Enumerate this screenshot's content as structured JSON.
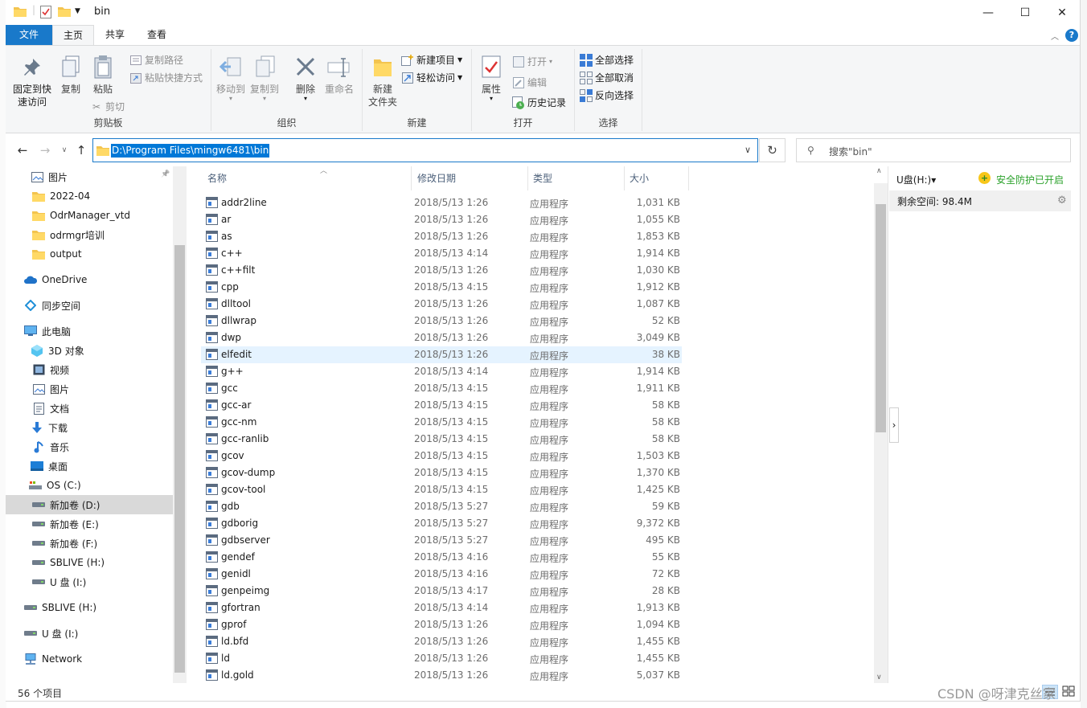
{
  "window": {
    "title": "bin",
    "controls": {
      "minimize": "—",
      "maximize": "☐",
      "close": "✕"
    }
  },
  "ribbon_tabs": [
    {
      "label": "文件"
    },
    {
      "label": "主页"
    },
    {
      "label": "共享"
    },
    {
      "label": "查看"
    }
  ],
  "ribbon": {
    "clipboard": {
      "pin_label_1": "固定到快",
      "pin_label_2": "速访问",
      "copy": "复制",
      "paste": "粘贴",
      "copy_path": "复制路径",
      "paste_shortcut": "粘贴快捷方式",
      "cut": "剪切",
      "group": "剪贴板"
    },
    "organize": {
      "move_to": "移动到",
      "copy_to": "复制到",
      "delete": "删除",
      "rename": "重命名",
      "group": "组织"
    },
    "new": {
      "new_folder_1": "新建",
      "new_folder_2": "文件夹",
      "new_item": "新建项目",
      "easy_access": "轻松访问",
      "group": "新建"
    },
    "open": {
      "properties": "属性",
      "open": "打开",
      "edit": "编辑",
      "history": "历史记录",
      "group": "打开"
    },
    "select": {
      "select_all": "全部选择",
      "select_none": "全部取消",
      "invert": "反向选择",
      "group": "选择"
    }
  },
  "address": {
    "path": "D:\\Program Files\\mingw6481\\bin"
  },
  "search": {
    "placeholder": "搜索\"bin\""
  },
  "nav": [
    {
      "label": "图片",
      "icon": "pictures-icon"
    },
    {
      "label": "2022-04",
      "icon": "folder-icon"
    },
    {
      "label": "OdrManager_vtd",
      "icon": "folder-icon"
    },
    {
      "label": "odrmgr培训",
      "icon": "folder-icon"
    },
    {
      "label": "output",
      "icon": "folder-icon"
    },
    {
      "label": "OneDrive",
      "icon": "onedrive-icon"
    },
    {
      "label": "同步空间",
      "icon": "sync-icon"
    },
    {
      "label": "此电脑",
      "icon": "computer-icon"
    },
    {
      "label": "3D 对象",
      "icon": "3d-objects-icon"
    },
    {
      "label": "视频",
      "icon": "video-icon"
    },
    {
      "label": "图片",
      "icon": "pictures-icon"
    },
    {
      "label": "文档",
      "icon": "documents-icon"
    },
    {
      "label": "下载",
      "icon": "download-icon"
    },
    {
      "label": "音乐",
      "icon": "music-icon"
    },
    {
      "label": "桌面",
      "icon": "desktop-icon"
    },
    {
      "label": "OS (C:)",
      "icon": "os-drive-icon"
    },
    {
      "label": "新加卷 (D:)",
      "icon": "drive-icon"
    },
    {
      "label": "新加卷 (E:)",
      "icon": "drive-icon"
    },
    {
      "label": "新加卷 (F:)",
      "icon": "drive-icon"
    },
    {
      "label": "SBLIVE (H:)",
      "icon": "drive-icon"
    },
    {
      "label": "U 盘 (I:)",
      "icon": "drive-icon"
    },
    {
      "label": "SBLIVE (H:)",
      "icon": "drive-icon"
    },
    {
      "label": "U 盘 (I:)",
      "icon": "drive-icon"
    },
    {
      "label": "Network",
      "icon": "network-icon"
    }
  ],
  "columns": {
    "name": "名称",
    "date": "修改日期",
    "type": "类型",
    "size": "大小"
  },
  "files": [
    {
      "name": "addr2line",
      "date": "2018/5/13 1:26",
      "type": "应用程序",
      "size": "1,031 KB"
    },
    {
      "name": "ar",
      "date": "2018/5/13 1:26",
      "type": "应用程序",
      "size": "1,055 KB"
    },
    {
      "name": "as",
      "date": "2018/5/13 1:26",
      "type": "应用程序",
      "size": "1,853 KB"
    },
    {
      "name": "c++",
      "date": "2018/5/13 4:14",
      "type": "应用程序",
      "size": "1,914 KB"
    },
    {
      "name": "c++filt",
      "date": "2018/5/13 1:26",
      "type": "应用程序",
      "size": "1,030 KB"
    },
    {
      "name": "cpp",
      "date": "2018/5/13 4:15",
      "type": "应用程序",
      "size": "1,912 KB"
    },
    {
      "name": "dlltool",
      "date": "2018/5/13 1:26",
      "type": "应用程序",
      "size": "1,087 KB"
    },
    {
      "name": "dllwrap",
      "date": "2018/5/13 1:26",
      "type": "应用程序",
      "size": "52 KB"
    },
    {
      "name": "dwp",
      "date": "2018/5/13 1:26",
      "type": "应用程序",
      "size": "3,049 KB"
    },
    {
      "name": "elfedit",
      "date": "2018/5/13 1:26",
      "type": "应用程序",
      "size": "38 KB"
    },
    {
      "name": "g++",
      "date": "2018/5/13 4:14",
      "type": "应用程序",
      "size": "1,914 KB"
    },
    {
      "name": "gcc",
      "date": "2018/5/13 4:15",
      "type": "应用程序",
      "size": "1,911 KB"
    },
    {
      "name": "gcc-ar",
      "date": "2018/5/13 4:15",
      "type": "应用程序",
      "size": "58 KB"
    },
    {
      "name": "gcc-nm",
      "date": "2018/5/13 4:15",
      "type": "应用程序",
      "size": "58 KB"
    },
    {
      "name": "gcc-ranlib",
      "date": "2018/5/13 4:15",
      "type": "应用程序",
      "size": "58 KB"
    },
    {
      "name": "gcov",
      "date": "2018/5/13 4:15",
      "type": "应用程序",
      "size": "1,503 KB"
    },
    {
      "name": "gcov-dump",
      "date": "2018/5/13 4:15",
      "type": "应用程序",
      "size": "1,370 KB"
    },
    {
      "name": "gcov-tool",
      "date": "2018/5/13 4:15",
      "type": "应用程序",
      "size": "1,425 KB"
    },
    {
      "name": "gdb",
      "date": "2018/5/13 5:27",
      "type": "应用程序",
      "size": "59 KB"
    },
    {
      "name": "gdborig",
      "date": "2018/5/13 5:27",
      "type": "应用程序",
      "size": "9,372 KB"
    },
    {
      "name": "gdbserver",
      "date": "2018/5/13 5:27",
      "type": "应用程序",
      "size": "495 KB"
    },
    {
      "name": "gendef",
      "date": "2018/5/13 4:16",
      "type": "应用程序",
      "size": "55 KB"
    },
    {
      "name": "genidl",
      "date": "2018/5/13 4:16",
      "type": "应用程序",
      "size": "72 KB"
    },
    {
      "name": "genpeimg",
      "date": "2018/5/13 4:17",
      "type": "应用程序",
      "size": "28 KB"
    },
    {
      "name": "gfortran",
      "date": "2018/5/13 4:14",
      "type": "应用程序",
      "size": "1,913 KB"
    },
    {
      "name": "gprof",
      "date": "2018/5/13 1:26",
      "type": "应用程序",
      "size": "1,094 KB"
    },
    {
      "name": "ld.bfd",
      "date": "2018/5/13 1:26",
      "type": "应用程序",
      "size": "1,455 KB"
    },
    {
      "name": "ld",
      "date": "2018/5/13 1:26",
      "type": "应用程序",
      "size": "1,455 KB"
    },
    {
      "name": "ld.gold",
      "date": "2018/5/13 1:26",
      "type": "应用程序",
      "size": "5,037 KB"
    }
  ],
  "sidepanel": {
    "drive": "U盘(H:)▾",
    "status": "安全防护已开启",
    "free_space": "剩余空间: 98.4M"
  },
  "status": {
    "count": "56 个项目"
  },
  "watermark": "CSDN @呀津克丝家"
}
